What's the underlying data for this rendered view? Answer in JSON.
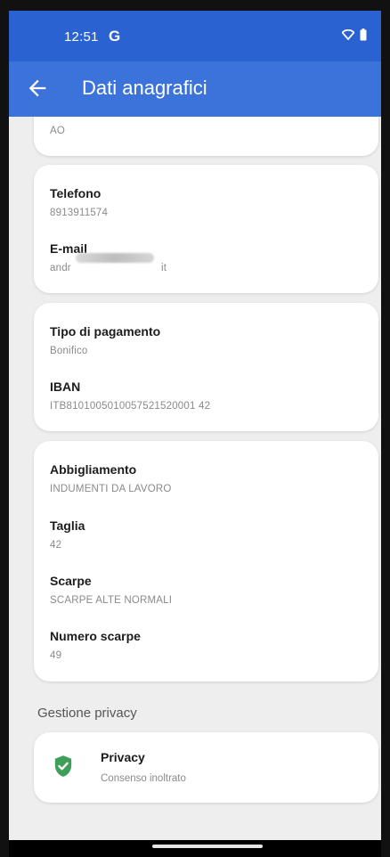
{
  "status": {
    "time": "12:51",
    "g_logo": "G",
    "wifi_icon": "wifi-icon",
    "battery_icon": "battery-icon"
  },
  "appbar": {
    "title": "Dati anagrafici",
    "back_icon": "arrow-back-icon"
  },
  "cards": {
    "top_partial": {
      "value": "AO"
    },
    "contact": {
      "phone_label": "Telefono",
      "phone_value": "8913911574",
      "email_label": "E-mail",
      "email_prefix": "andr",
      "email_suffix": "it"
    },
    "payment": {
      "type_label": "Tipo di pagamento",
      "type_value": "Bonifico",
      "iban_label": "IBAN",
      "iban_value": "ITB8101005010057521520001 42"
    },
    "clothing": {
      "abb_label": "Abbigliamento",
      "abb_value": "INDUMENTI DA LAVORO",
      "size_label": "Taglia",
      "size_value": "42",
      "shoes_label": "Scarpe",
      "shoes_value": "SCARPE ALTE NORMALI",
      "shoe_size_label": "Numero scarpe",
      "shoe_size_value": "49"
    }
  },
  "privacy": {
    "section_title": "Gestione privacy",
    "title": "Privacy",
    "subtitle": "Consenso inoltrato",
    "icon": "shield-check-icon",
    "icon_color": "#3f9e5a"
  },
  "colors": {
    "status_bar": "#2a63d1",
    "app_bar": "#3b73db",
    "background": "#eeeeee"
  }
}
